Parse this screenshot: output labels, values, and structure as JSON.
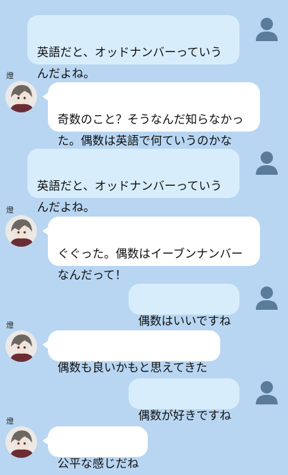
{
  "contact": {
    "name": "燈"
  },
  "messages": [
    {
      "side": "right",
      "text": "英語だと、オッドナンバーっていうんだよね。"
    },
    {
      "side": "left",
      "text": "奇数のこと？そうなんだ知らなかった。偶数は英語で何ていうのかな"
    },
    {
      "side": "right",
      "text": "英語だと、オッドナンバーっていうんだよね。"
    },
    {
      "side": "left",
      "text": "ぐぐった。偶数はイーブンナンバーなんだって！"
    },
    {
      "side": "right",
      "text": "偶数はいいですね"
    },
    {
      "side": "left",
      "text": "偶数も良いかもと思えてきた"
    },
    {
      "side": "right",
      "text": "偶数が好きですね"
    },
    {
      "side": "left",
      "text": "公平な感じだね"
    }
  ],
  "colors": {
    "background": "#b8d6f2",
    "bubble_self": "#d8edfb",
    "bubble_other": "#ffffff",
    "user_icon": "#5a7b9a"
  },
  "icons": {
    "self": "person-silhouette-icon",
    "other": "character-avatar"
  }
}
